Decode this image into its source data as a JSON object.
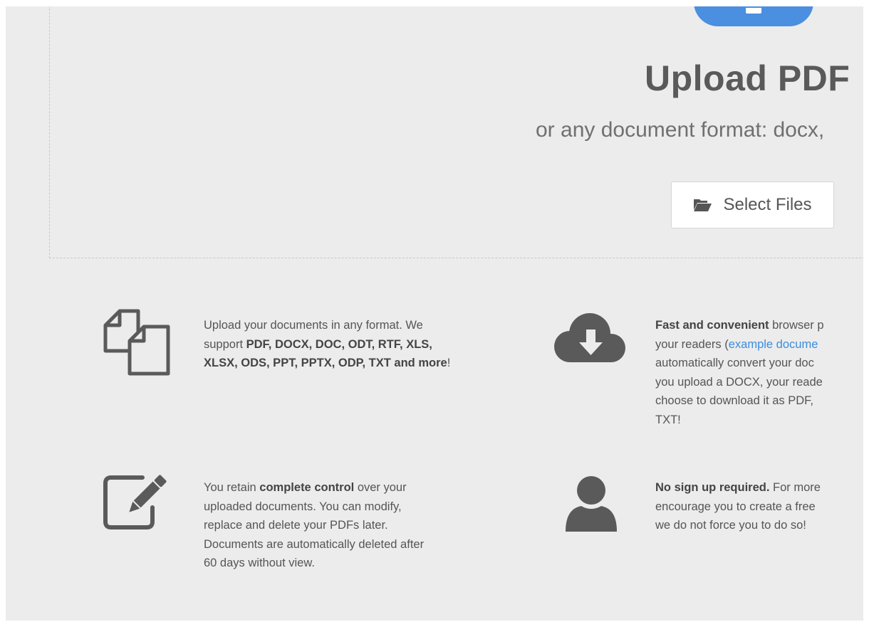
{
  "hero": {
    "title": "Upload PDF",
    "subtitle": "or any document format: docx,",
    "select_button_label": "Select Files"
  },
  "features": {
    "formats": {
      "line1": "Upload your documents in any format. We",
      "line2_prefix": "support ",
      "line2_bold": "PDF, DOCX, DOC, ODT, RTF, XLS,",
      "line3_bold": "XLSX, ODS, PPT, PPTX, ODP, TXT and more",
      "line3_suffix": "!"
    },
    "download": {
      "line1_bold": "Fast and convenient",
      "line1_rest": " browser p",
      "line2_prefix": "your readers (",
      "line2_link": "example docume",
      "line3": "automatically convert your doc",
      "line4": "you upload a DOCX, your reade",
      "line5": "choose to download it as PDF,",
      "line6": "TXT!"
    },
    "control": {
      "line1_prefix": "You retain ",
      "line1_bold": "complete control",
      "line1_suffix": " over your",
      "line2": "uploaded documents. You can modify,",
      "line3": "replace and delete your PDFs later.",
      "line4": "Documents are automatically deleted after",
      "line5": "60 days without view."
    },
    "signup": {
      "line1_bold": "No sign up required.",
      "line1_rest": " For more",
      "line2": "encourage you to create a free",
      "line3": "we do not force you to do so!"
    }
  }
}
